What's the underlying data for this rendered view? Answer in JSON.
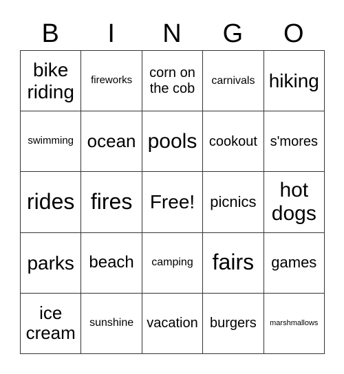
{
  "header": [
    "B",
    "I",
    "N",
    "G",
    "O"
  ],
  "rows": [
    [
      {
        "text": "bike riding",
        "size": "s28"
      },
      {
        "text": "fireworks",
        "size": "s15"
      },
      {
        "text": "corn on the cob",
        "size": "s20"
      },
      {
        "text": "carnivals",
        "size": "s16"
      },
      {
        "text": "hiking",
        "size": "s28"
      }
    ],
    [
      {
        "text": "swimming",
        "size": "s15"
      },
      {
        "text": "ocean",
        "size": "s26"
      },
      {
        "text": "pools",
        "size": "s30"
      },
      {
        "text": "cookout",
        "size": "s20"
      },
      {
        "text": "s'mores",
        "size": "s20"
      }
    ],
    [
      {
        "text": "rides",
        "size": "s32"
      },
      {
        "text": "fires",
        "size": "s32"
      },
      {
        "text": "Free!",
        "size": "s28"
      },
      {
        "text": "picnics",
        "size": "s22"
      },
      {
        "text": "hot dogs",
        "size": "s30"
      }
    ],
    [
      {
        "text": "parks",
        "size": "s28"
      },
      {
        "text": "beach",
        "size": "s24"
      },
      {
        "text": "camping",
        "size": "s16"
      },
      {
        "text": "fairs",
        "size": "s32"
      },
      {
        "text": "games",
        "size": "s22"
      }
    ],
    [
      {
        "text": "ice cream",
        "size": "s26"
      },
      {
        "text": "sunshine",
        "size": "s16"
      },
      {
        "text": "vacation",
        "size": "s20"
      },
      {
        "text": "burgers",
        "size": "s20"
      },
      {
        "text": "marshmallows",
        "size": "s11"
      }
    ]
  ]
}
